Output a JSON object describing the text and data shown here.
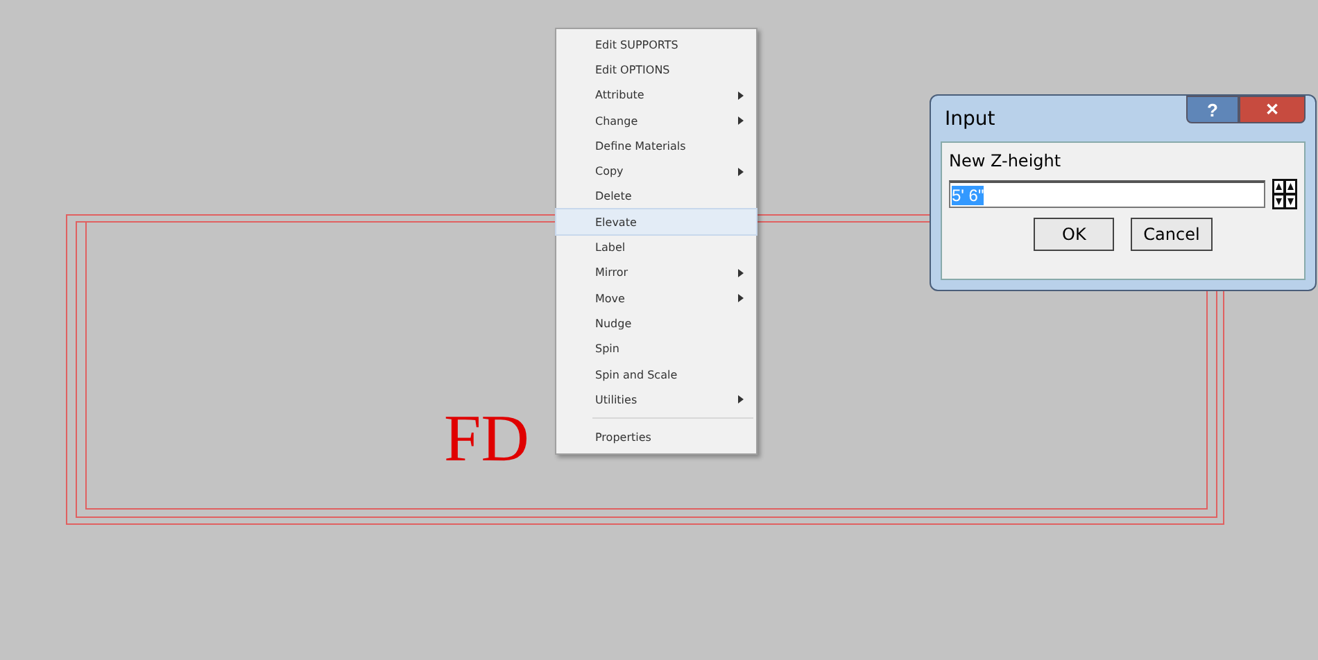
{
  "canvas": {
    "label": "FD"
  },
  "context_menu": {
    "items": [
      {
        "kind": "item",
        "label": "Edit SUPPORTS",
        "submenu": false,
        "selected": false
      },
      {
        "kind": "item",
        "label": "Edit OPTIONS",
        "submenu": false,
        "selected": false
      },
      {
        "kind": "item",
        "label": "Attribute",
        "submenu": true,
        "selected": false
      },
      {
        "kind": "item",
        "label": "Change",
        "submenu": true,
        "selected": false
      },
      {
        "kind": "item",
        "label": "Define Materials",
        "submenu": false,
        "selected": false
      },
      {
        "kind": "item",
        "label": "Copy",
        "submenu": true,
        "selected": false
      },
      {
        "kind": "item",
        "label": "Delete",
        "submenu": false,
        "selected": false
      },
      {
        "kind": "item",
        "label": "Elevate",
        "submenu": false,
        "selected": true
      },
      {
        "kind": "item",
        "label": "Label",
        "submenu": false,
        "selected": false
      },
      {
        "kind": "item",
        "label": "Mirror",
        "submenu": true,
        "selected": false
      },
      {
        "kind": "item",
        "label": "Move",
        "submenu": true,
        "selected": false
      },
      {
        "kind": "item",
        "label": "Nudge",
        "submenu": false,
        "selected": false
      },
      {
        "kind": "item",
        "label": "Spin",
        "submenu": false,
        "selected": false
      },
      {
        "kind": "item",
        "label": "Spin and Scale",
        "submenu": false,
        "selected": false
      },
      {
        "kind": "item",
        "label": "Utilities",
        "submenu": true,
        "selected": false
      },
      {
        "kind": "separator"
      },
      {
        "kind": "item",
        "label": "Properties",
        "submenu": false,
        "selected": false
      }
    ]
  },
  "dialog": {
    "title": "Input",
    "help_button": "?",
    "close_button": "✕",
    "prompt": "New Z-height",
    "value": "5' 6\"",
    "buttons": [
      "OK",
      "Cancel"
    ]
  }
}
